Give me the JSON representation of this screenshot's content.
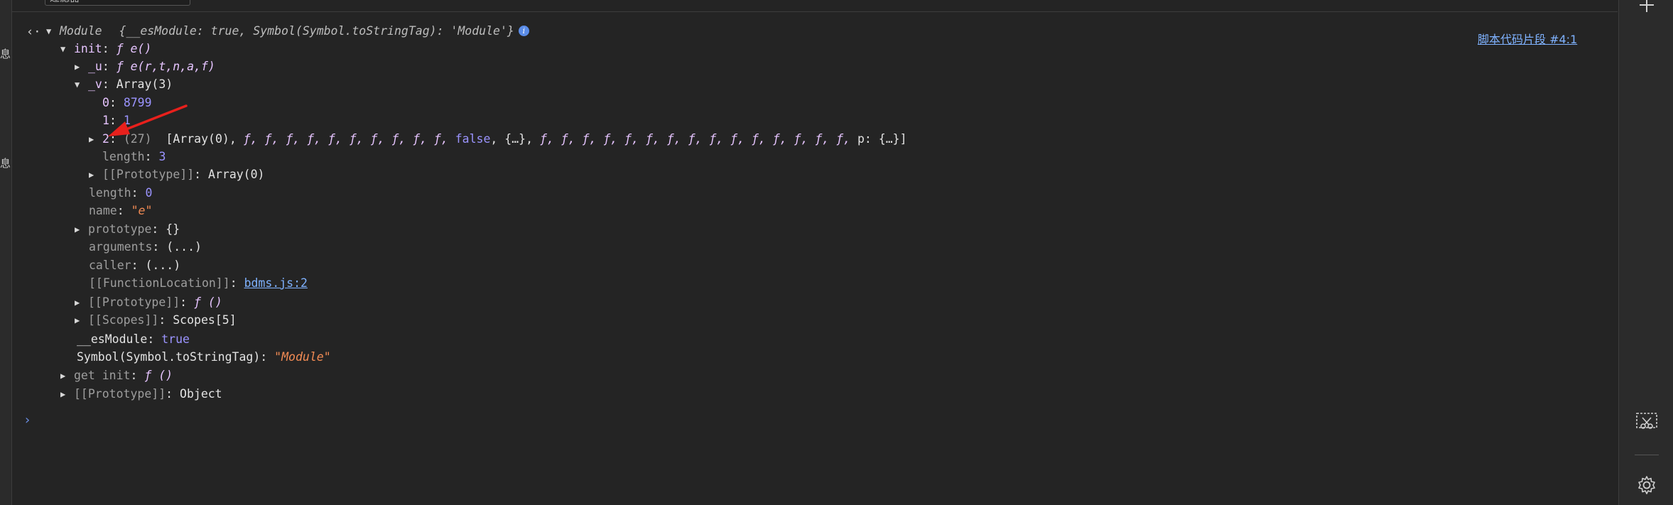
{
  "left_panel": {
    "glyphs": [
      "息",
      "息"
    ]
  },
  "top_bar": {
    "filter_value": "过滤器"
  },
  "right_bar": {
    "icons": [
      "add-icon",
      "screen-snip-icon",
      "settings-gear-icon"
    ]
  },
  "console": {
    "source_link": "脚本代码片段 #4:1",
    "header": {
      "type": "Module",
      "preview": "{__esModule: true, Symbol(Symbol.toStringTag): 'Module'}"
    },
    "init": {
      "key": "init",
      "value": "ƒ e()"
    },
    "u": {
      "key": "_u",
      "value": "ƒ e(r,t,n,a,f)"
    },
    "v": {
      "key": "_v",
      "value": "Array(3)"
    },
    "v_items": [
      {
        "key": "0",
        "value": "8799"
      },
      {
        "key": "1",
        "value": "1"
      }
    ],
    "v_item2": {
      "key": "2",
      "count": "(27)",
      "preview_start": "[Array(0), ",
      "funcs_a": "ƒ, ƒ, ƒ, ƒ, ƒ, ƒ, ƒ, ƒ, ƒ, ƒ, ",
      "false_val": "false",
      "mid": ", {…}, ",
      "funcs_b": "ƒ, ƒ, ƒ, ƒ, ƒ, ƒ, ƒ, ƒ, ƒ, ƒ, ƒ, ƒ, ƒ, ƒ, ƒ, ",
      "end": "p: {…}]"
    },
    "v_length": {
      "key": "length",
      "value": "3"
    },
    "v_prototype": {
      "key": "[[Prototype]]",
      "value": "Array(0)"
    },
    "fn_length": {
      "key": "length",
      "value": "0"
    },
    "fn_name": {
      "key": "name",
      "value": "\"e\""
    },
    "fn_prototype": {
      "key": "prototype",
      "value": "{}"
    },
    "fn_arguments": {
      "key": "arguments",
      "value": "(...)"
    },
    "fn_caller": {
      "key": "caller",
      "value": "(...)"
    },
    "fn_location": {
      "key": "[[FunctionLocation]]",
      "value": "bdms.js:2"
    },
    "fn_proto": {
      "key": "[[Prototype]]",
      "value": "ƒ ()"
    },
    "fn_scopes": {
      "key": "[[Scopes]]",
      "value": "Scopes[5]"
    },
    "es_module": {
      "key": "__esModule",
      "value": "true"
    },
    "to_string_tag": {
      "key": "Symbol(Symbol.toStringTag)",
      "value": "\"Module\""
    },
    "get_init": {
      "key": "get init",
      "value": "ƒ ()"
    },
    "module_proto": {
      "key": "[[Prototype]]",
      "value": "Object"
    }
  },
  "colors": {
    "background": "#242424",
    "key_purple": "#e6c4ff",
    "number_blue": "#9b94ff",
    "string_orange": "#f28b54",
    "link_blue": "#7fb2ff",
    "annotation_red": "#e8201c"
  }
}
